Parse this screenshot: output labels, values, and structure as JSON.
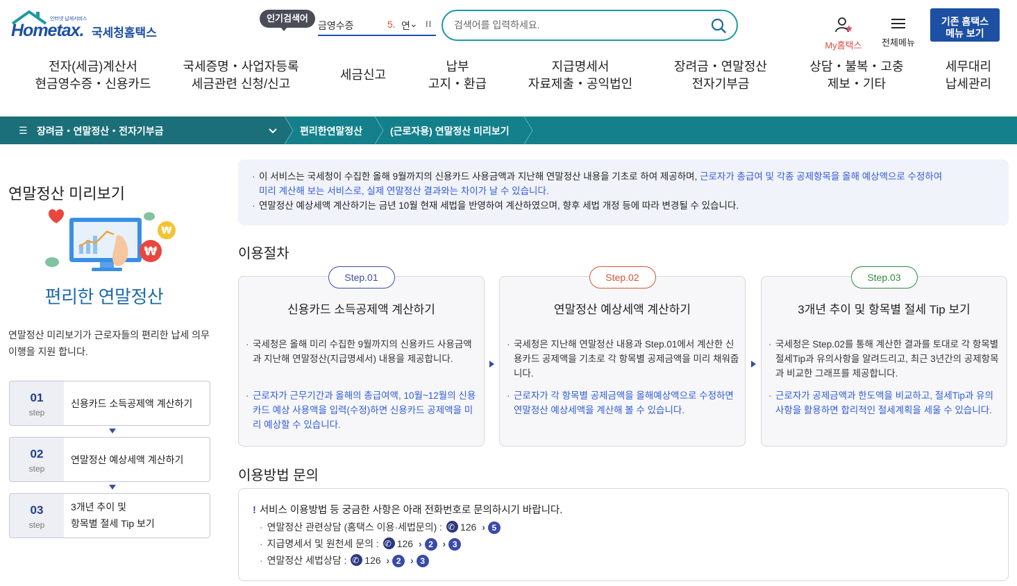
{
  "header": {
    "logo_text": "Hometax.",
    "logo_kr": "국세청홈택스",
    "logo_tagline": "인터넷 납세서비스",
    "popular_label": "인기검색어",
    "popular_term": "금영수증",
    "popular_rank": "5.",
    "popular_term2": "연",
    "search_placeholder": "검색어를 입력하세요.",
    "my_hometax": "My홈택스",
    "all_menu": "전체메뉴",
    "legacy_line1": "기존 홈택스",
    "legacy_line2": "메뉴 보기"
  },
  "nav": [
    {
      "line1": "전자(세금)계산서",
      "line2": "현금영수증・신용카드"
    },
    {
      "line1": "국세증명・사업자등록",
      "line2": "세금관련 신청/신고"
    },
    {
      "line1": "세금신고",
      "line2": ""
    },
    {
      "line1": "납부",
      "line2": "고지・환급"
    },
    {
      "line1": "지급명세서",
      "line2": "자료제출・공익법인"
    },
    {
      "line1": "장려금・연말정산",
      "line2": "전자기부금"
    },
    {
      "line1": "상담・불복・고충",
      "line2": "제보・기타"
    },
    {
      "line1": "세무대리",
      "line2": "납세관리"
    }
  ],
  "breadcrumb": {
    "first": "장려금・연말정산・전자기부금",
    "second": "편리한연말정산",
    "third": "(근로자용) 연말정산 미리보기"
  },
  "left": {
    "title": "연말정산 미리보기",
    "subtitle": "편리한 연말정산",
    "desc": "연말정산 미리보기가 근로자들의  편리한 납세 의무 이행을 지원 합니다.",
    "steps": [
      {
        "num": "01",
        "label": "step",
        "text1": "신용카드 소득공제액 계산하기",
        "text2": ""
      },
      {
        "num": "02",
        "label": "step",
        "text1": "연말정산 예상세액 계산하기",
        "text2": ""
      },
      {
        "num": "03",
        "label": "step",
        "text1": "3개년 추이 및",
        "text2": "항목별 절세 Tip 보기"
      }
    ]
  },
  "notice": {
    "line1_a": "이 서비스는 국세청이 수집한 올해 9월까지의 신용카드 사용금액과 지난해 연말정산 내용을 기초로 하여 제공하며, ",
    "line1_b": "근로자가 총급여 및 각종 공제항목을 올해 예상액으로 수정하여",
    "line1_c": "미리 계산해 보는 서비스로, 실제 연말정산 결과와는 차이가 날 수 있습니다.",
    "line2": "연말정산 예상세액 계산하기는 금년 10월 현재 세법을 반영하여 계산하였으며, 향후 세법 개정 등에 따라 변경될 수 있습니다."
  },
  "procedure": {
    "title": "이용절차",
    "steps": [
      {
        "badge": "Step.01",
        "badge_color": "#3a4da3",
        "title": "신용카드 소득공제액 계산하기",
        "text": "국세청은 올해 미리 수집한 9월까지의 신용카드 사용금액과 지난해 연말정산(지급명세서) 내용을 제공합니다.",
        "blue": "근로자가 근무기간과 올해의 총급여액, 10월~12월의 신용카드 예상 사용액을 입력(수정)하면 신용카드 공제액을 미리 예상할 수 있습니다."
      },
      {
        "badge": "Step.02",
        "badge_color": "#d9532f",
        "title": "연말정산 예상세액 계산하기",
        "text": "국세청은 지난해 연말정산 내용과 Step.01에서 계산한 신용카드 공제액을 기초로 각 항목별 공제금액을 미리 채워줍니다.",
        "blue": "근로자가 각 항목별 공제금액을 올해예상액으로 수정하면 연말정산 예상세액을 계산해 볼 수 있습니다."
      },
      {
        "badge": "Step.03",
        "badge_color": "#2f8a3f",
        "title": "3개년 추이 및 항목별 절세 Tip 보기",
        "text": "국세청은 Step.02를 통해 계산한 결과를 토대로 각 항목별 절세Tip과 유의사항을 알려드리고, 최근 3년간의 공제항목과 비교한 그래프를 제공합니다.",
        "blue": "근로자가 공제금액과 한도액을 비교하고, 절세Tip과 유의사항을 활용하면 합리적인 절세계획을 세울 수 있습니다."
      }
    ]
  },
  "contact": {
    "title": "이용방법 문의",
    "head": "서비스 이용방법 등 궁금한 사항은 아래 전화번호로 문의하시기 바랍니다.",
    "rows": [
      {
        "label": "연말정산 관련상담 (홈택스 이용·세법문의) :",
        "phone": "126",
        "c1": "5",
        "c2": ""
      },
      {
        "label": "지급명세서 및 원천세 문의 :",
        "phone": "126",
        "c1": "2",
        "c2": "3"
      },
      {
        "label": "연말정산 세법상담 :",
        "phone": "126",
        "c1": "2",
        "c2": "3"
      }
    ]
  }
}
